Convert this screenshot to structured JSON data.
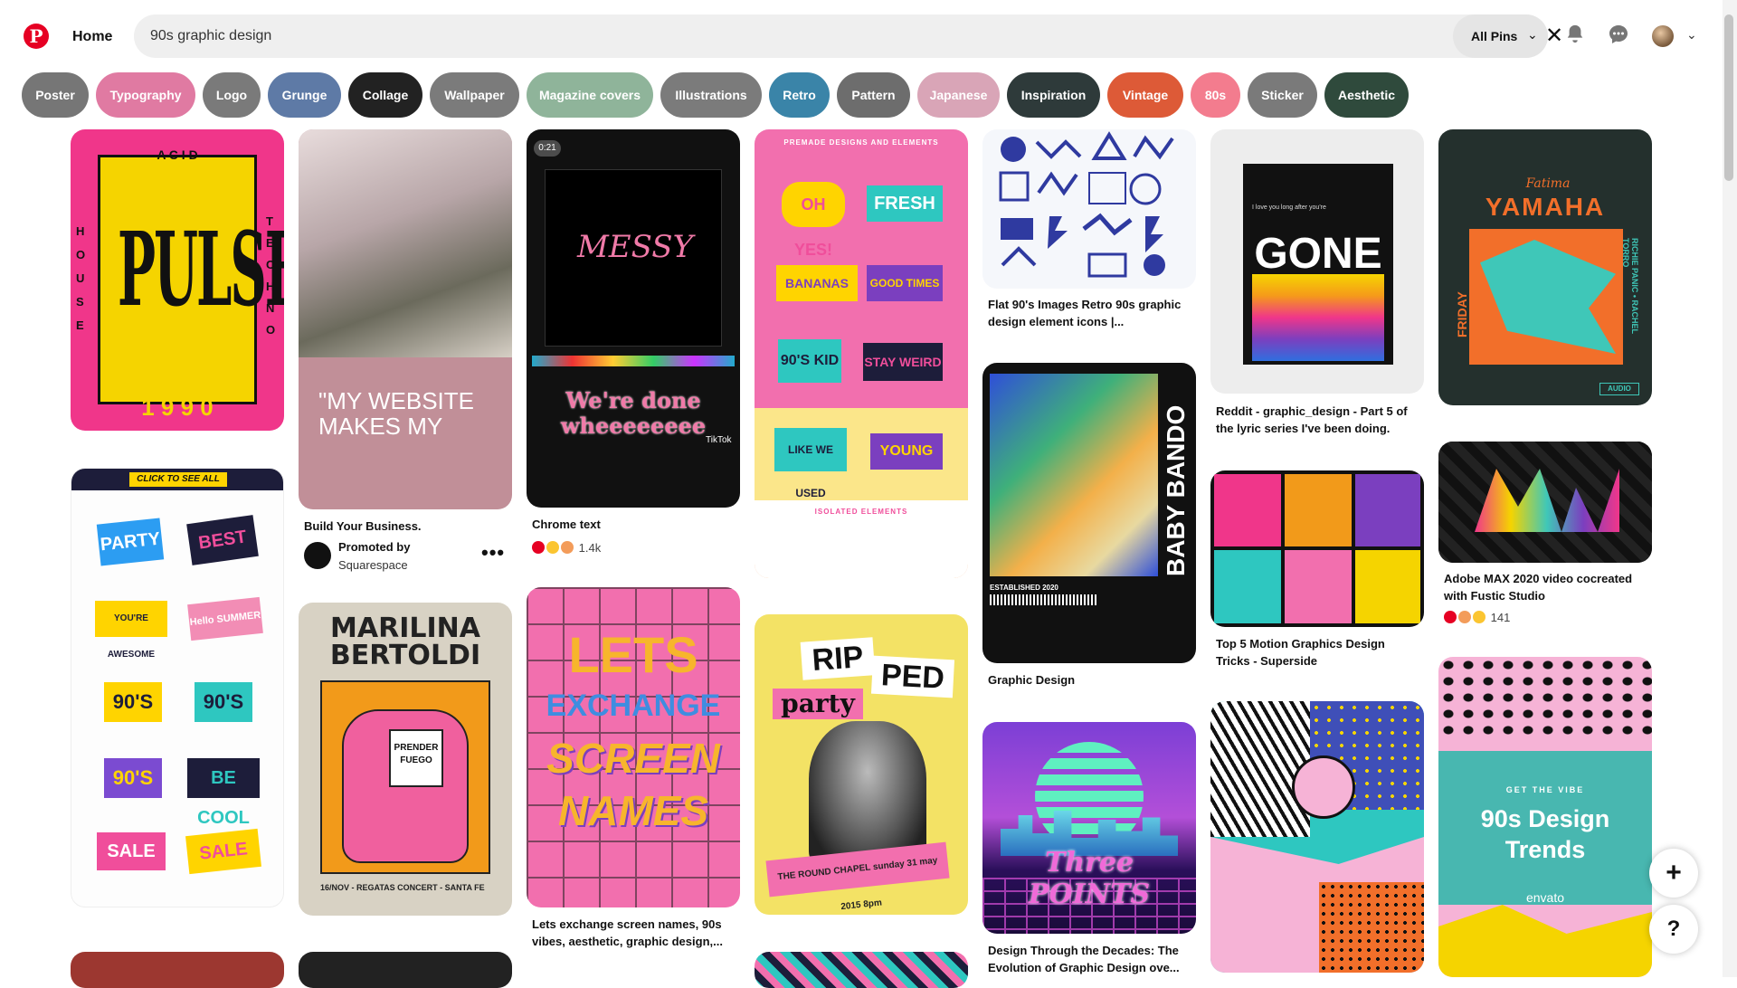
{
  "header": {
    "logo_letter": "P",
    "home_label": "Home",
    "search_value": "90s graphic design",
    "filter_label": "All Pins"
  },
  "chips": [
    {
      "label": "Poster",
      "color": "#767676"
    },
    {
      "label": "Typography",
      "color": "#e07aa2"
    },
    {
      "label": "Logo",
      "color": "#7a7a7a"
    },
    {
      "label": "Grunge",
      "color": "#5e7aa6"
    },
    {
      "label": "Collage",
      "color": "#222222"
    },
    {
      "label": "Wallpaper",
      "color": "#7b7b7b"
    },
    {
      "label": "Magazine covers",
      "color": "#8fb49a"
    },
    {
      "label": "Illustrations",
      "color": "#7b7b7b"
    },
    {
      "label": "Retro",
      "color": "#3a84a8"
    },
    {
      "label": "Pattern",
      "color": "#6d6d6d"
    },
    {
      "label": "Japanese",
      "color": "#d9a5b7"
    },
    {
      "label": "Inspiration",
      "color": "#2e3a3a"
    },
    {
      "label": "Vintage",
      "color": "#dd5a37"
    },
    {
      "label": "80s",
      "color": "#f37c8e"
    },
    {
      "label": "Sticker",
      "color": "#7a7a7a"
    },
    {
      "label": "Aesthetic",
      "color": "#2f4a3c"
    }
  ],
  "pins": {
    "pulse": {
      "top": "A C I D",
      "title": "PULSE",
      "left": "H O U S E",
      "right": "T E C H N O",
      "year": "1 9 9 0"
    },
    "website": {
      "text": "\"MY WEBSITE MAKES MY",
      "caption": "Build Your Business.",
      "promoted": "Promoted by",
      "advertiser": "Squarespace"
    },
    "messy": {
      "timer": "0:21",
      "heart": "MESSY",
      "overlay": "We're done wheeeeeeee",
      "tiktok": "TikTok",
      "caption": "Chrome text",
      "count": "1.4k"
    },
    "stickers": {
      "header": "PREMADE DESIGNS AND ELEMENTS",
      "w1": "OH YES!",
      "w2": "FRESH",
      "w3": "BANANAS",
      "w4": "GOOD TIMES",
      "w5": "90'S KID",
      "w6": "STAY WEIRD",
      "w7": "LIKE WE USED",
      "w8": "YOUNG",
      "footer": "ISOLATED ELEMENTS"
    },
    "icons": {
      "caption": "Flat 90's Images Retro 90s graphic design element icons |..."
    },
    "gone": {
      "small": "I love you long after you're",
      "title": "GONE",
      "caption": "Reddit - graphic_design - Part 5 of the lyric series I've been doing."
    },
    "yamaha": {
      "script": "Fatima",
      "title": "YAMAHA",
      "side": "FRIDAY",
      "names": "RICHIE PANIC • RACHEL TORRO",
      "tag": "AUDIO"
    },
    "party": {
      "banner": "CLICK TO SEE ALL",
      "s1": "PARTY",
      "s2": "BEST",
      "s3": "YOU'RE AWESOME",
      "s4": "Hello SUMMER",
      "s5": "90'S",
      "s6": "90'S",
      "s7": "90'S",
      "s8": "BE COOL",
      "s9": "SALE",
      "s10": "SALE"
    },
    "marilina": {
      "title": "MARILINA BERTOLDI",
      "box": "PRENDER FUEGO",
      "footer": "16/NOV - REGATAS CONCERT - SANTA FE"
    },
    "lets": {
      "l1": "LETS",
      "l2": "EXCHANGE",
      "l3": "SCREEN",
      "l4": "NAMES",
      "caption": "Lets exchange screen names, 90s vibes, aesthetic, graphic design,..."
    },
    "ripped": {
      "w1": "RIP",
      "w2": "PED",
      "w3": "party",
      "footer": "THE ROUND CHAPEL  sunday 31 may 2015  8pm"
    },
    "babybando": {
      "vertical": "BABY BANDO",
      "est": "ESTABLISHED 2020",
      "caption": "Graphic Design"
    },
    "adobe": {
      "caption": "Adobe MAX 2020 video cocreated with Fustic Studio",
      "count": "141"
    },
    "motion": {
      "caption": "Top 5 Motion Graphics Design Tricks - Superside"
    },
    "three": {
      "title": "Three POINTS",
      "caption": "Design Through the Decades: The Evolution of Graphic Design ove..."
    },
    "envato": {
      "small": "GET THE VIBE",
      "title": "90s Design Trends",
      "brand": "envato"
    }
  },
  "fab": {
    "plus": "+",
    "help": "?"
  },
  "colors": {
    "brand": "#e60023"
  }
}
